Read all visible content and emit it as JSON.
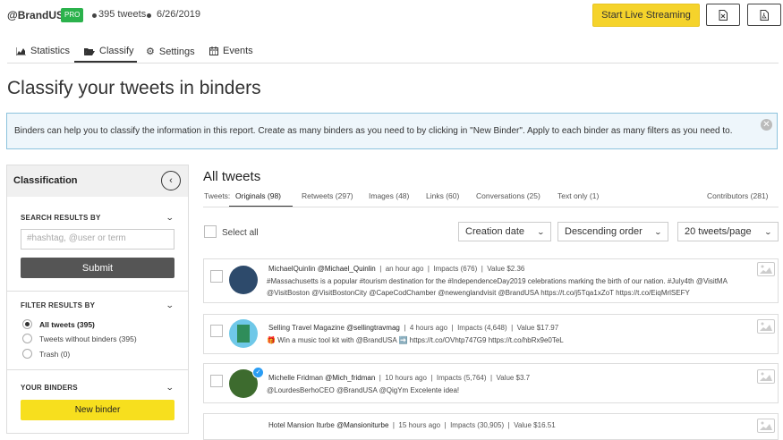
{
  "header": {
    "handle": "@BrandUSA",
    "badge": "PRO",
    "tweets_count": "395 tweets",
    "date": "6/26/2019",
    "live_button": "Start Live Streaming"
  },
  "nav_tabs": [
    {
      "label": "Statistics"
    },
    {
      "label": "Classify"
    },
    {
      "label": "Settings"
    },
    {
      "label": "Events"
    }
  ],
  "page_title": "Classify your tweets in binders",
  "info_text": "Binders can help you to classify the information in this report. Create as many binders as you need to by clicking in \"New Binder\". Apply to each binder as many filters as you need to.",
  "sidebar": {
    "title": "Classification",
    "search_label": "SEARCH RESULTS BY",
    "search_placeholder": "#hashtag, @user or term",
    "submit": "Submit",
    "filter_label": "FILTER RESULTS BY",
    "filters": [
      {
        "label": "All tweets (395)",
        "selected": true
      },
      {
        "label": "Tweets without binders (395)",
        "selected": false
      },
      {
        "label": "Trash (0)",
        "selected": false
      }
    ],
    "binders_label": "YOUR BINDERS",
    "new_binder": "New binder"
  },
  "main": {
    "title": "All tweets",
    "tweets_label": "Tweets:",
    "filter_tabs": [
      {
        "label": "Originals (98)",
        "active": true
      },
      {
        "label": "Retweets (297)",
        "active": false
      },
      {
        "label": "Images (48)",
        "active": false
      },
      {
        "label": "Links (60)",
        "active": false
      },
      {
        "label": "Conversations (25)",
        "active": false
      },
      {
        "label": "Text only (1)",
        "active": false
      }
    ],
    "contributors": "Contributors (281)",
    "select_all": "Select all",
    "sort_field": "Creation date",
    "sort_order": "Descending order",
    "per_page": "20 tweets/page"
  },
  "tweets": [
    {
      "name": "MichaelQuinlin",
      "user": "@Michael_Quinlin",
      "time": "an hour ago",
      "impacts": "Impacts (676)",
      "value": "Value $2.36",
      "line1": "#Massachusetts is a popular #tourism destination for the #IndependenceDay2019 celebrations marking the birth of our nation. #July4th @VisitMA",
      "line2": "@VisitBoston @VisitBostonCity @CapeCodChamber @newenglandvisit @BrandUSA https://t.co/j5Tqa1xZoT https://t.co/EiqMrlSEFY",
      "avatar_color": "#2d4a6b"
    },
    {
      "name": "Selling Travel Magazine",
      "user": "@sellingtravmag",
      "time": "4 hours ago",
      "impacts": "Impacts (4,648)",
      "value": "Value $17.97",
      "line1": "🎁 Win a music tool kit with @BrandUSA ➡️ https://t.co/OVhtp747G9 https://t.co/hbRx9e0TeL",
      "line2": "",
      "avatar_color": "#3aa37a"
    },
    {
      "name": "Michelle Fridman",
      "user": "@Mich_fridman",
      "time": "10 hours ago",
      "impacts": "Impacts (5,764)",
      "value": "Value $3.7",
      "line1": "@LourdesBerhoCEO @BrandUSA @QigYm Excelente idea!",
      "line2": "",
      "avatar_color": "#3d6b2e"
    },
    {
      "name": "Hotel Mansion Iturbe",
      "user": "@Mansioniturbe",
      "time": "15 hours ago",
      "impacts": "Impacts (30,905)",
      "value": "Value $16.51",
      "line1": "",
      "line2": "",
      "avatar_color": "#888888"
    }
  ]
}
